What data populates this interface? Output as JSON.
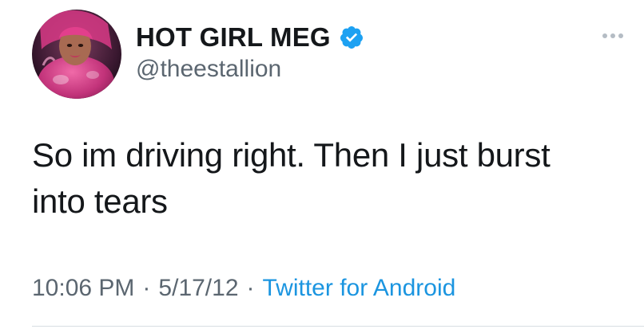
{
  "author": {
    "display_name": "HOT GIRL MEG",
    "handle": "@theestallion",
    "verified": true,
    "avatar_icon": "profile-photo"
  },
  "tweet": {
    "text_line_1": "So im driving right. Then I just burst",
    "text_line_2": "into tears"
  },
  "meta": {
    "time": "10:06 PM",
    "separator": "·",
    "date": "5/17/12",
    "source": "Twitter for Android"
  },
  "colors": {
    "verified_badge": "#1da1f2",
    "link": "#1b95e0",
    "secondary_text": "#5b6670",
    "primary_text": "#14171a"
  },
  "icons": {
    "more": "more-dots-icon",
    "verified": "verified-badge-icon"
  }
}
